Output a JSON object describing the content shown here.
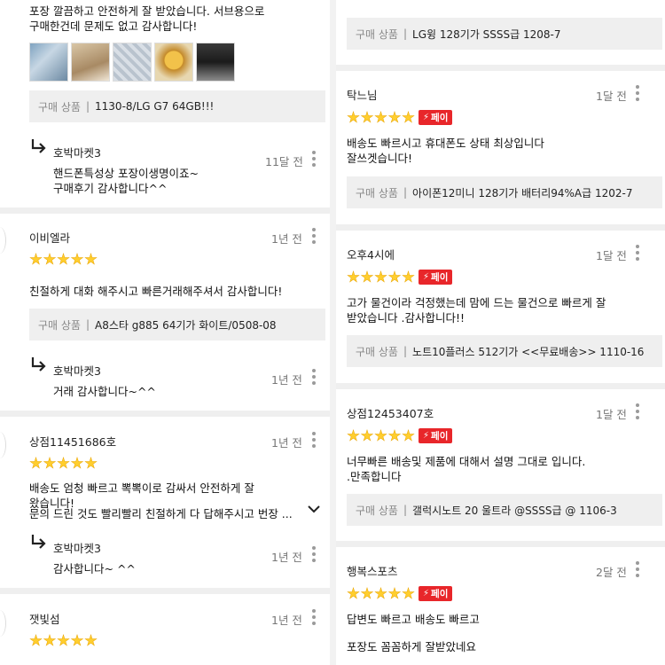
{
  "left": {
    "review1": {
      "text_line1": "포장 깔끔하고 안전하게 잘 받았습니다. 서브용으로",
      "text_line2": "구매한건데 문제도 없고 감사합니다!",
      "product_label": "구매 상품",
      "product_name": "1130-8/LG G7 64GB!!!",
      "reply_name": "호박마켓3",
      "reply_time": "11달 전",
      "reply_line1": "핸드폰특성상 포장이생명이죠~",
      "reply_line2": "구매후기 감사합니다^^"
    },
    "review2": {
      "name": "이비엘라",
      "time": "1년 전",
      "rating": 5,
      "text_line1": "친절하게 대화 해주시고 빠른거래해주셔서  감사합니다!",
      "product_label": "구매 상품",
      "product_name": "A8스타 g885 64기가 화이트/0508-08",
      "reply_name": "호박마켓3",
      "reply_time": "1년 전",
      "reply_line1": "거래 감사합니다~^^"
    },
    "review3": {
      "name": "상점11451686호",
      "time": "1년 전",
      "rating": 5,
      "text_line1": "배송도 엄청 빠르고 뽁뽁이로 감싸서 안전하게 잘",
      "text_line2": "왔습니다!",
      "text_line3": "문의 드린 것도 빨리빨리 친절하게 다 답해주시고 번장 ...",
      "reply_name": "호박마켓3",
      "reply_time": "1년 전",
      "reply_line1": "감사합니다~ ^^"
    },
    "review4": {
      "name": "잿빛섬",
      "time": "1년 전",
      "rating": 5
    }
  },
  "right": {
    "review1": {
      "product_label": "구매 상품",
      "product_name": "LG윙 128기가 SSSS급 1208-7"
    },
    "review2": {
      "name": "탁느님",
      "time": "1달 전",
      "rating": 5,
      "pay_label": "페이",
      "text_line1": "배송도 빠르시고 휴대폰도 상태 최상입니다",
      "text_line2": "잘쓰겟습니다!",
      "product_label": "구매 상품",
      "product_name": "아이폰12미니 128기가 배터리94%A급 1202-7"
    },
    "review3": {
      "name": "오후4시에",
      "time": "1달 전",
      "rating": 5,
      "pay_label": "페이",
      "text_line1": "고가 물건이라 걱정했는데 맘에 드는 물건으로 빠르게 잘",
      "text_line2": "받았습니다 .감사합니다!!",
      "product_label": "구매 상품",
      "product_name": "노트10플러스 512기가 <<무료배송>> 1110-16"
    },
    "review4": {
      "name": "상점12453407호",
      "time": "1달 전",
      "rating": 5,
      "pay_label": "페이",
      "text_line1": "너무빠른 배송및 제품에 대해서 설명 그대로 입니다.",
      "text_line2": ".만족합니다",
      "product_label": "구매 상품",
      "product_name": "갤럭시노트 20 울트라 @SSSS급 @ 1106-3"
    },
    "review5": {
      "name": "행복스포츠",
      "time": "2달 전",
      "rating": 5,
      "pay_label": "페이",
      "text_line1": "답변도 빠르고 배송도 빠르고",
      "text_line2": "포장도 꼼꼼하게 잘받았네요"
    }
  },
  "icons": {
    "more": "more-vertical-icon",
    "reply": "reply-arrow-icon",
    "expand": "chevron-down-icon",
    "pay": "lightning-icon"
  },
  "colors": {
    "star": "#ffce2e",
    "pay_badge": "#e8262a",
    "product_bg": "#efefef"
  }
}
